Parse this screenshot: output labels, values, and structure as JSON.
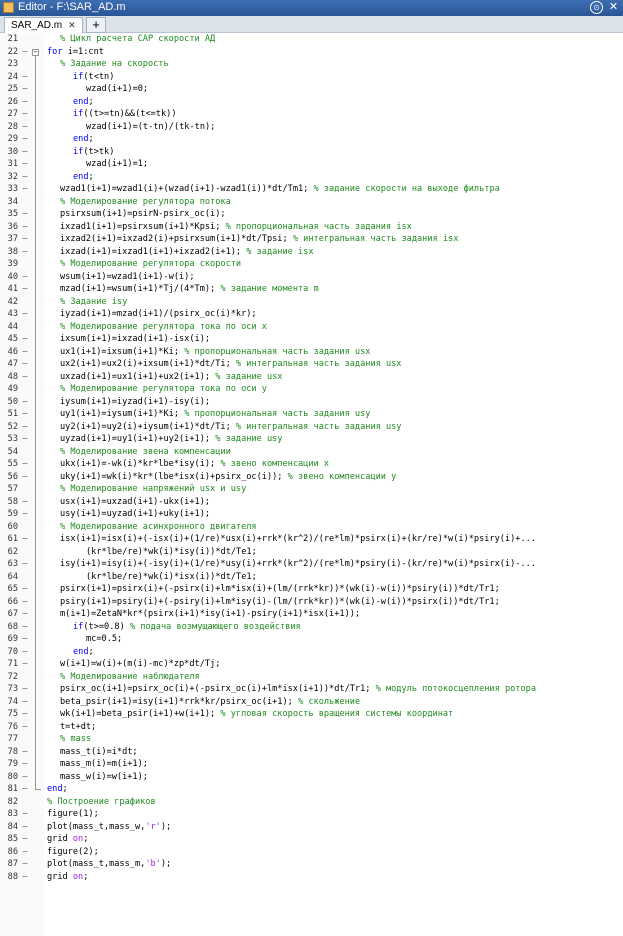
{
  "window": {
    "title": "Editor - F:\\SAR_AD.m",
    "menu_icon": "⊙",
    "close_icon": "✕"
  },
  "tabs": [
    {
      "label": "SAR_AD.m",
      "close": "✕"
    }
  ],
  "add_tab_label": "+",
  "colors": {
    "keyword": "#0000ff",
    "comment": "#228b22",
    "string": "#a020f0"
  },
  "lines": [
    {
      "n": "21",
      "m": "",
      "indent": 1,
      "segs": [
        {
          "t": "% Цикл расчета САР скорости АД",
          "c": "cm"
        }
      ]
    },
    {
      "n": "22",
      "m": "—",
      "indent": 0,
      "fold": true,
      "segs": [
        {
          "t": "for",
          "c": "kw"
        },
        {
          "t": " i=1:cnt"
        }
      ]
    },
    {
      "n": "23",
      "m": "",
      "indent": 1,
      "segs": [
        {
          "t": "% Задание на скорость",
          "c": "cm"
        }
      ]
    },
    {
      "n": "24",
      "m": "—",
      "indent": 2,
      "segs": [
        {
          "t": "if",
          "c": "kw"
        },
        {
          "t": "(t<tn)"
        }
      ]
    },
    {
      "n": "25",
      "m": "—",
      "indent": 3,
      "segs": [
        {
          "t": "wzad(i+1)=0;"
        }
      ]
    },
    {
      "n": "26",
      "m": "—",
      "indent": 2,
      "segs": [
        {
          "t": "end",
          "c": "kw"
        },
        {
          "t": ";"
        }
      ]
    },
    {
      "n": "27",
      "m": "—",
      "indent": 2,
      "segs": [
        {
          "t": "if",
          "c": "kw"
        },
        {
          "t": "((t>=tn)&&(t<=tk))"
        }
      ]
    },
    {
      "n": "28",
      "m": "—",
      "indent": 3,
      "segs": [
        {
          "t": "wzad(i+1)=(t-tn)/(tk-tn);"
        }
      ]
    },
    {
      "n": "29",
      "m": "—",
      "indent": 2,
      "segs": [
        {
          "t": "end",
          "c": "kw"
        },
        {
          "t": ";"
        }
      ]
    },
    {
      "n": "30",
      "m": "—",
      "indent": 2,
      "segs": [
        {
          "t": "if",
          "c": "kw"
        },
        {
          "t": "(t>tk)"
        }
      ]
    },
    {
      "n": "31",
      "m": "—",
      "indent": 3,
      "segs": [
        {
          "t": "wzad(i+1)=1;"
        }
      ]
    },
    {
      "n": "32",
      "m": "—",
      "indent": 2,
      "segs": [
        {
          "t": "end",
          "c": "kw"
        },
        {
          "t": ";"
        }
      ]
    },
    {
      "n": "33",
      "m": "—",
      "indent": 1,
      "segs": [
        {
          "t": "wzad1(i+1)=wzad1(i)+(wzad(i+1)-wzad1(i))*dt/Tm1; "
        },
        {
          "t": "% задание скорости на выходе фильтра",
          "c": "cm"
        }
      ]
    },
    {
      "n": "34",
      "m": "",
      "indent": 1,
      "segs": [
        {
          "t": "% Моделирование регулятора потока",
          "c": "cm"
        }
      ]
    },
    {
      "n": "35",
      "m": "—",
      "indent": 1,
      "segs": [
        {
          "t": "psirxsum(i+1)=psirN-psirx_oc(i);"
        }
      ]
    },
    {
      "n": "36",
      "m": "—",
      "indent": 1,
      "segs": [
        {
          "t": "ixzad1(i+1)=psirxsum(i+1)*Kpsi; "
        },
        {
          "t": "% пропорциональная часть задания isx",
          "c": "cm"
        }
      ]
    },
    {
      "n": "37",
      "m": "—",
      "indent": 1,
      "segs": [
        {
          "t": "ixzad2(i+1)=ixzad2(i)+psirxsum(i+1)*dt/Tpsi; "
        },
        {
          "t": "% интегральная часть задания isx",
          "c": "cm"
        }
      ]
    },
    {
      "n": "38",
      "m": "—",
      "indent": 1,
      "segs": [
        {
          "t": "ixzad(i+1)=ixzad1(i+1)+ixzad2(i+1); "
        },
        {
          "t": "% задание isx",
          "c": "cm"
        }
      ]
    },
    {
      "n": "39",
      "m": "",
      "indent": 1,
      "segs": [
        {
          "t": "% Моделирование регулятора скорости",
          "c": "cm"
        }
      ]
    },
    {
      "n": "40",
      "m": "—",
      "indent": 1,
      "segs": [
        {
          "t": "wsum(i+1)=wzad1(i+1)-w(i);"
        }
      ]
    },
    {
      "n": "41",
      "m": "—",
      "indent": 1,
      "segs": [
        {
          "t": "mzad(i+1)=wsum(i+1)*Tj/(4*Tm); "
        },
        {
          "t": "% задание момента m",
          "c": "cm"
        }
      ]
    },
    {
      "n": "42",
      "m": "",
      "indent": 1,
      "segs": [
        {
          "t": "% Задание isy",
          "c": "cm"
        }
      ]
    },
    {
      "n": "43",
      "m": "—",
      "indent": 1,
      "segs": [
        {
          "t": "iyzad(i+1)=mzad(i+1)/(psirx_oc(i)*kr);"
        }
      ]
    },
    {
      "n": "44",
      "m": "",
      "indent": 1,
      "segs": [
        {
          "t": "% Моделирование регулятора тока по оси x",
          "c": "cm"
        }
      ]
    },
    {
      "n": "45",
      "m": "—",
      "indent": 1,
      "segs": [
        {
          "t": "ixsum(i+1)=ixzad(i+1)-isx(i);"
        }
      ]
    },
    {
      "n": "46",
      "m": "—",
      "indent": 1,
      "segs": [
        {
          "t": "ux1(i+1)=ixsum(i+1)*Ki; "
        },
        {
          "t": "% пропорциональная часть задания usx",
          "c": "cm"
        }
      ]
    },
    {
      "n": "47",
      "m": "—",
      "indent": 1,
      "segs": [
        {
          "t": "ux2(i+1)=ux2(i)+ixsum(i+1)*dt/Ti; "
        },
        {
          "t": "% интегральная часть задания usx",
          "c": "cm"
        }
      ]
    },
    {
      "n": "48",
      "m": "—",
      "indent": 1,
      "segs": [
        {
          "t": "uxzad(i+1)=ux1(i+1)+ux2(i+1); "
        },
        {
          "t": "% задание usx",
          "c": "cm"
        }
      ]
    },
    {
      "n": "49",
      "m": "",
      "indent": 1,
      "segs": [
        {
          "t": "% Моделирование регулятора тока по оси y",
          "c": "cm"
        }
      ]
    },
    {
      "n": "50",
      "m": "—",
      "indent": 1,
      "segs": [
        {
          "t": "iysum(i+1)=iyzad(i+1)-isy(i);"
        }
      ]
    },
    {
      "n": "51",
      "m": "—",
      "indent": 1,
      "segs": [
        {
          "t": "uy1(i+1)=iysum(i+1)*Ki; "
        },
        {
          "t": "% пропорциональная часть задания usy",
          "c": "cm"
        }
      ]
    },
    {
      "n": "52",
      "m": "—",
      "indent": 1,
      "segs": [
        {
          "t": "uy2(i+1)=uy2(i)+iysum(i+1)*dt/Ti; "
        },
        {
          "t": "% интегральная часть задания usy",
          "c": "cm"
        }
      ]
    },
    {
      "n": "53",
      "m": "—",
      "indent": 1,
      "segs": [
        {
          "t": "uyzad(i+1)=uy1(i+1)+uy2(i+1); "
        },
        {
          "t": "% задание usy",
          "c": "cm"
        }
      ]
    },
    {
      "n": "54",
      "m": "",
      "indent": 1,
      "segs": [
        {
          "t": "% Моделирование звена компенсации",
          "c": "cm"
        }
      ]
    },
    {
      "n": "55",
      "m": "—",
      "indent": 1,
      "segs": [
        {
          "t": "ukx(i+1)=-wk(i)*kr*lbe*isy(i); "
        },
        {
          "t": "% звено компенсации x",
          "c": "cm"
        }
      ]
    },
    {
      "n": "56",
      "m": "—",
      "indent": 1,
      "segs": [
        {
          "t": "uky(i+1)=wk(i)*kr*(lbe*isx(i)+psirx_oc(i)); "
        },
        {
          "t": "% звено компенсации y",
          "c": "cm"
        }
      ]
    },
    {
      "n": "57",
      "m": "",
      "indent": 1,
      "segs": [
        {
          "t": "% Моделирование напряжений usx и usy",
          "c": "cm"
        }
      ]
    },
    {
      "n": "58",
      "m": "—",
      "indent": 1,
      "segs": [
        {
          "t": "usx(i+1)=uxzad(i+1)-ukx(i+1);"
        }
      ]
    },
    {
      "n": "59",
      "m": "—",
      "indent": 1,
      "segs": [
        {
          "t": "usy(i+1)=uyzad(i+1)+uky(i+1);"
        }
      ]
    },
    {
      "n": "60",
      "m": "",
      "indent": 1,
      "segs": [
        {
          "t": "% Моделирование асинхронного двигателя",
          "c": "cm"
        }
      ]
    },
    {
      "n": "61",
      "m": "—",
      "indent": 1,
      "segs": [
        {
          "t": "isx(i+1)=isx(i)+(-isx(i)+(1/re)*usx(i)+rrk*(kr^2)/(re*lm)*psirx(i)+(kr/re)*w(i)*psiry(i)+..."
        }
      ]
    },
    {
      "n": "62",
      "m": "",
      "indent": 3,
      "segs": [
        {
          "t": "(kr*lbe/re)*wk(i)*isy(i))*dt/Te1;"
        }
      ]
    },
    {
      "n": "63",
      "m": "—",
      "indent": 1,
      "segs": [
        {
          "t": "isy(i+1)=isy(i)+(-isy(i)+(1/re)*usy(i)+rrk*(kr^2)/(re*lm)*psiry(i)-(kr/re)*w(i)*psirx(i)-..."
        }
      ]
    },
    {
      "n": "64",
      "m": "",
      "indent": 3,
      "segs": [
        {
          "t": "(kr*lbe/re)*wk(i)*isx(i))*dt/Te1;"
        }
      ]
    },
    {
      "n": "65",
      "m": "—",
      "indent": 1,
      "segs": [
        {
          "t": "psirx(i+1)=psirx(i)+(-psirx(i)+lm*isx(i)+(lm/(rrk*kr))*(wk(i)-w(i))*psiry(i))*dt/Tr1;"
        }
      ]
    },
    {
      "n": "66",
      "m": "—",
      "indent": 1,
      "segs": [
        {
          "t": "psiry(i+1)=psiry(i)+(-psiry(i)+lm*isy(i)-(lm/(rrk*kr))*(wk(i)-w(i))*psirx(i))*dt/Tr1;"
        }
      ]
    },
    {
      "n": "67",
      "m": "—",
      "indent": 1,
      "segs": [
        {
          "t": "m(i+1)=ZetaN*kr*(psirx(i+1)*isy(i+1)-psiry(i+1)*isx(i+1));"
        }
      ]
    },
    {
      "n": "68",
      "m": "—",
      "indent": 2,
      "segs": [
        {
          "t": "if",
          "c": "kw"
        },
        {
          "t": "(t>=0.8) "
        },
        {
          "t": "% подача возмущающего воздействия",
          "c": "cm"
        }
      ]
    },
    {
      "n": "69",
      "m": "—",
      "indent": 3,
      "segs": [
        {
          "t": "mc=0.5;"
        }
      ]
    },
    {
      "n": "70",
      "m": "—",
      "indent": 2,
      "segs": [
        {
          "t": "end",
          "c": "kw"
        },
        {
          "t": ";"
        }
      ]
    },
    {
      "n": "71",
      "m": "—",
      "indent": 1,
      "segs": [
        {
          "t": "w(i+1)=w(i)+(m(i)-mc)*zp*dt/Tj;"
        }
      ]
    },
    {
      "n": "72",
      "m": "",
      "indent": 1,
      "segs": [
        {
          "t": "% Моделирование наблюдателя",
          "c": "cm"
        }
      ]
    },
    {
      "n": "73",
      "m": "—",
      "indent": 1,
      "segs": [
        {
          "t": "psirx_oc(i+1)=psirx_oc(i)+(-psirx_oc(i)+lm*isx(i+1))*dt/Tr1; "
        },
        {
          "t": "% модуль потокосцепления ротора",
          "c": "cm"
        }
      ]
    },
    {
      "n": "74",
      "m": "—",
      "indent": 1,
      "segs": [
        {
          "t": "beta_psir(i+1)=isy(i+1)*rrk*kr/psirx_oc(i+1); "
        },
        {
          "t": "% скольжение",
          "c": "cm"
        }
      ]
    },
    {
      "n": "75",
      "m": "—",
      "indent": 1,
      "segs": [
        {
          "t": "wk(i+1)=beta_psir(i+1)+w(i+1); "
        },
        {
          "t": "% угловая скорость вращения системы координат",
          "c": "cm"
        }
      ]
    },
    {
      "n": "76",
      "m": "—",
      "indent": 1,
      "segs": [
        {
          "t": "t=t+dt;"
        }
      ]
    },
    {
      "n": "77",
      "m": "",
      "indent": 1,
      "segs": [
        {
          "t": "% mass",
          "c": "cm"
        }
      ]
    },
    {
      "n": "78",
      "m": "—",
      "indent": 1,
      "segs": [
        {
          "t": "mass_t(i)=i*dt;"
        }
      ]
    },
    {
      "n": "79",
      "m": "—",
      "indent": 1,
      "segs": [
        {
          "t": "mass_m(i)=m(i+1);"
        }
      ]
    },
    {
      "n": "80",
      "m": "—",
      "indent": 1,
      "segs": [
        {
          "t": "mass_w(i)=w(i+1);"
        }
      ]
    },
    {
      "n": "81",
      "m": "—",
      "indent": 0,
      "foldend": true,
      "segs": [
        {
          "t": "end",
          "c": "kw"
        },
        {
          "t": ";"
        }
      ]
    },
    {
      "n": "82",
      "m": "",
      "indent": 0,
      "segs": [
        {
          "t": "% Построение графиков",
          "c": "cm"
        }
      ]
    },
    {
      "n": "83",
      "m": "—",
      "indent": 0,
      "segs": [
        {
          "t": "figure(1);"
        }
      ]
    },
    {
      "n": "84",
      "m": "—",
      "indent": 0,
      "segs": [
        {
          "t": "plot(mass_t,mass_w,"
        },
        {
          "t": "'r'",
          "c": "str"
        },
        {
          "t": ");"
        }
      ]
    },
    {
      "n": "85",
      "m": "—",
      "indent": 0,
      "segs": [
        {
          "t": "grid "
        },
        {
          "t": "on",
          "c": "str"
        },
        {
          "t": ";"
        }
      ]
    },
    {
      "n": "86",
      "m": "—",
      "indent": 0,
      "segs": [
        {
          "t": "figure(2);"
        }
      ]
    },
    {
      "n": "87",
      "m": "—",
      "indent": 0,
      "segs": [
        {
          "t": "plot(mass_t,mass_m,"
        },
        {
          "t": "'b'",
          "c": "str"
        },
        {
          "t": ");"
        }
      ]
    },
    {
      "n": "88",
      "m": "—",
      "indent": 0,
      "segs": [
        {
          "t": "grid "
        },
        {
          "t": "on",
          "c": "str"
        },
        {
          "t": ";"
        }
      ]
    }
  ]
}
